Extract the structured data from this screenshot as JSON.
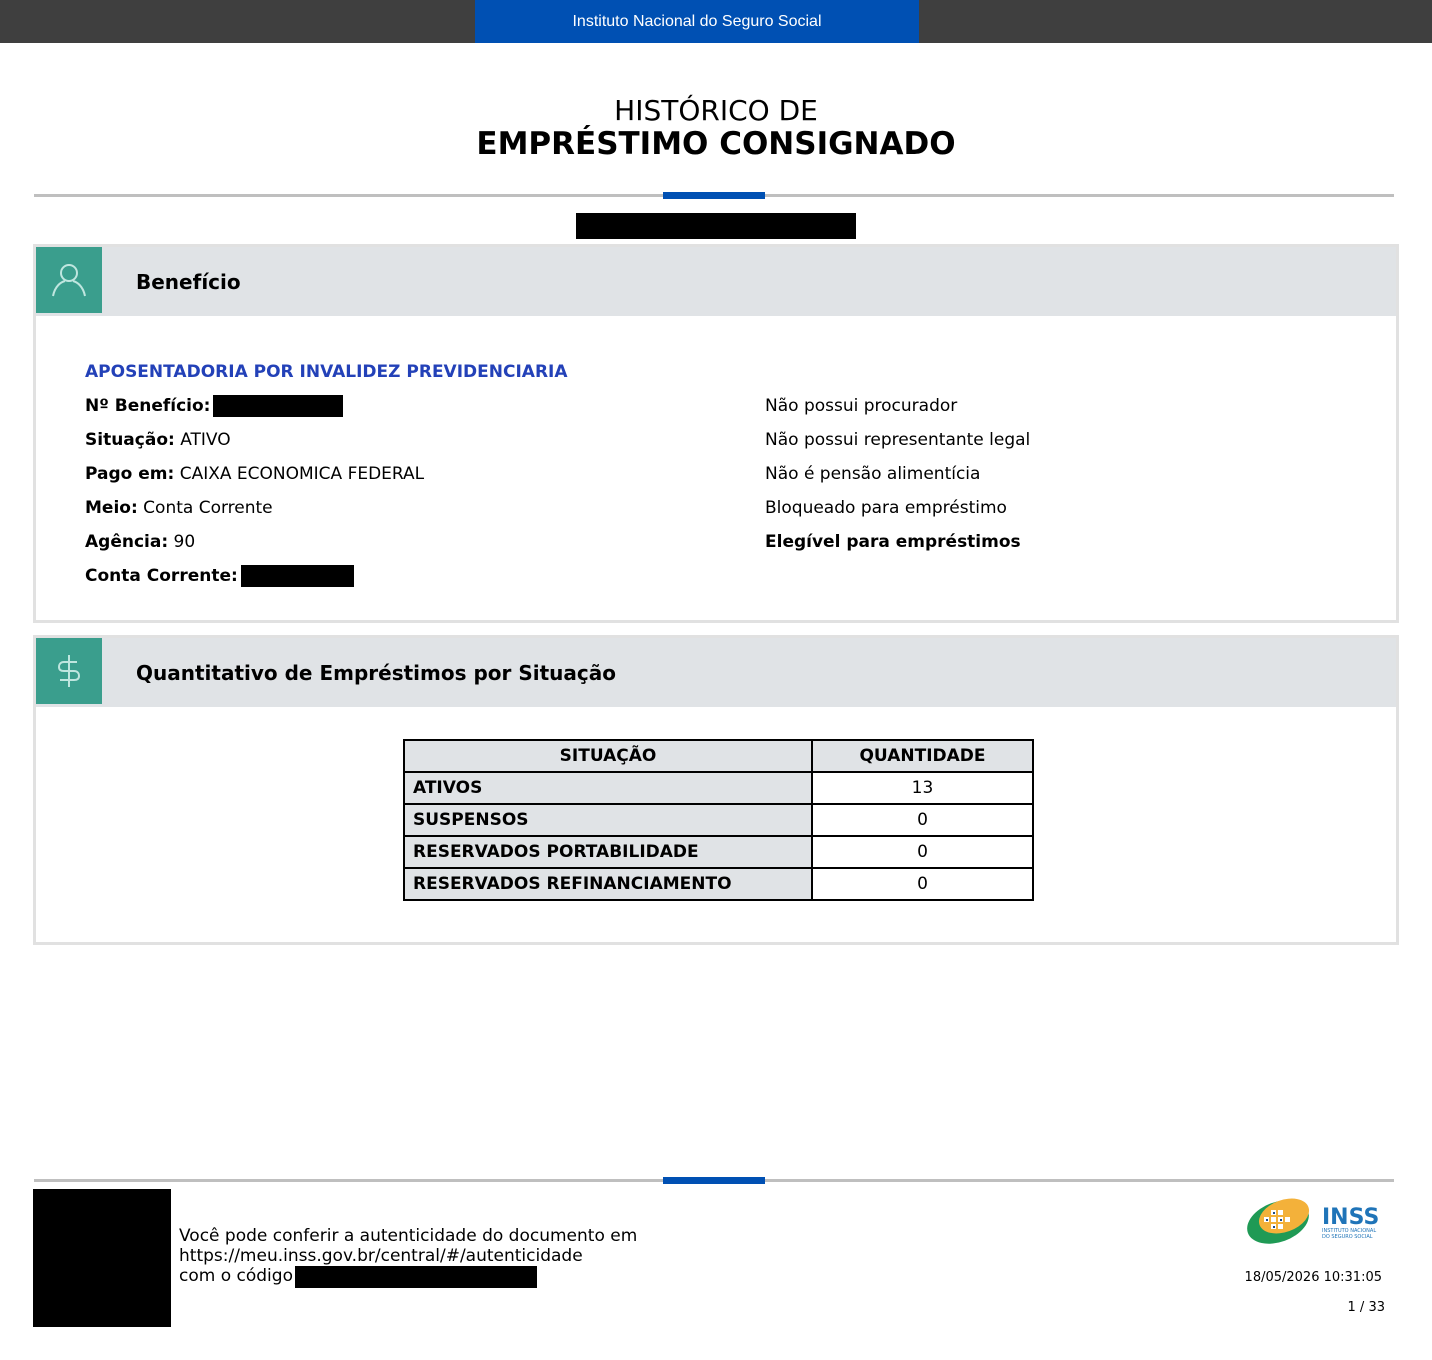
{
  "header": {
    "agency_name": "Instituto Nacional do Seguro Social"
  },
  "title": {
    "line1": "HISTÓRICO DE",
    "line2": "EMPRÉSTIMO CONSIGNADO"
  },
  "beneficio": {
    "section_title": "Benefício",
    "icon": "user-icon",
    "type": "APOSENTADORIA POR INVALIDEZ PREVIDENCIARIA",
    "numero_label": "Nº Benefício:",
    "situacao_label": "Situação:",
    "situacao_value": "ATIVO",
    "pago_label": "Pago em:",
    "pago_value": "CAIXA ECONOMICA FEDERAL",
    "meio_label": "Meio:",
    "meio_value": "Conta Corrente",
    "agencia_label": "Agência:",
    "agencia_value": "90",
    "conta_label": "Conta Corrente:",
    "right": [
      "Não possui procurador",
      "Não possui representante legal",
      "Não é pensão alimentícia",
      "Bloqueado para empréstimo",
      "Elegível para empréstimos"
    ]
  },
  "quantitativo": {
    "section_title": "Quantitativo de Empréstimos por Situação",
    "icon": "dollar-icon",
    "headers": [
      "SITUAÇÃO",
      "QUANTIDADE"
    ],
    "rows": [
      {
        "label": "ATIVOS",
        "value": "13"
      },
      {
        "label": "SUSPENSOS",
        "value": "0"
      },
      {
        "label": "RESERVADOS PORTABILIDADE",
        "value": "0"
      },
      {
        "label": "RESERVADOS REFINANCIAMENTO",
        "value": "0"
      }
    ]
  },
  "footer": {
    "line1": "Você pode conferir a autenticidade do documento em",
    "line2": "https://meu.inss.gov.br/central/#/autenticidade",
    "line3": "com o código",
    "logo_text": "INSS",
    "logo_subtext_1": "INSTITUTO NACIONAL",
    "logo_subtext_2": "DO SEGURO SOCIAL",
    "timestamp": "18/05/2026 10:31:05",
    "page": "1 / 33"
  },
  "colors": {
    "brand_blue": "#0050b3",
    "teal": "#3a9e8d",
    "header_gray": "#e0e3e6",
    "link_blue": "#2341b8"
  }
}
